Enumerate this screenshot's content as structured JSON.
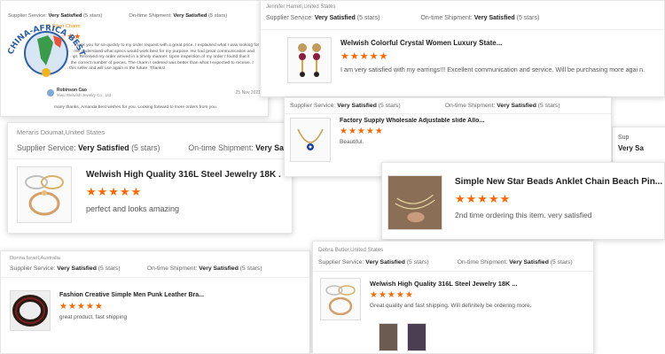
{
  "watermark": {
    "text": "CHINA-AFRICA BEST TRADING PLATFORM"
  },
  "card1": {
    "supplier_label": "Supplier Service:",
    "supplier_value": "Very Satisfied",
    "supplier_stars": "(5 stars)",
    "shipment_label": "On-time Shipment:",
    "shipment_value": "Very Satisfied",
    "shipment_stars": "(5 stars)",
    "badge": "#1 Silver Charm",
    "review": "I just want to... thank you for so quickly to my order request with a great price. I explained what I was looking for and he helped me understand what specs would work best for my purpose. He had great communication and was very prompt. Received my order arrived in a timely manner. Upon inspection of my order I found that it contained all the correct number of pieces. The charm I ordered was better than what I expected to receive. I recommend this seller and will use again in the future. Thanks!",
    "reply_name": "Robinson Cao",
    "reply_company": "Yiwu Welwish Jewelry Co., Ltd",
    "reply_date": "25 Nov 2021",
    "reply_text": "many thanks, Amanda,best wishes for you. Looking forward to more orders from you."
  },
  "card2": {
    "reviewer": "Jennifer Harrell,United States",
    "supplier_label": "Supplier Service:",
    "supplier_value": "Very Satisfied",
    "supplier_stars": "(5 stars)",
    "shipment_label": "On-time Shipment:",
    "shipment_value": "Very Satisfied",
    "shipment_stars": "(5 stars)",
    "product_title": "Welwish Colorful Crystal Women Luxury State...",
    "stars": "★★★★★",
    "review": "I am very satisfied with my earrings!!! Excellent communication and service. Will be purchasing more agai n."
  },
  "card3": {
    "supplier_label": "Supplier Service:",
    "supplier_value": "Very Satisfied",
    "supplier_stars": "(5 stars)",
    "shipment_label": "On-time Shipment:",
    "shipment_value": "Very Satisfied",
    "shipment_stars": "(5 stars)",
    "product_title": "Factory Supply Wholesale Adjustable slide Allo...",
    "stars": "★★★★★",
    "review": "Beautiful."
  },
  "card4": {
    "reviewer": "Meraris Doumat,United States",
    "supplier_label": "Supplier Service:",
    "supplier_value": "Very Satisfied",
    "supplier_stars": "(5 stars)",
    "shipment_label": "On-time Shipment:",
    "shipment_value": "Very Satisfied",
    "product_title": "Welwish High Quality 316L Steel Jewelry 18K ...",
    "stars": "★★★★★",
    "review": "perfect and looks amazing"
  },
  "card5": {
    "product_title": "Simple New Star Beads Anklet Chain Beach Pin...",
    "stars": "★★★★★",
    "review": "2nd time ordering this item. very satisfied"
  },
  "card6": {
    "reviewer": "Donna Israel,Australia",
    "supplier_label": "Supplier Service:",
    "supplier_value": "Very Satisfied",
    "supplier_stars": "(5 stars)",
    "shipment_label": "On-time Shipment:",
    "shipment_value": "Very Satisfied",
    "shipment_stars": "(5 stars)",
    "product_title": "Fashion Creative Simple Men Punk Leather Bra...",
    "stars": "★★★★★",
    "review": "great product, fast shipping"
  },
  "card7": {
    "reviewer": "Debra Butler,United States",
    "supplier_label": "Supplier Service:",
    "supplier_value": "Very Satisfied",
    "supplier_stars": "(5 stars)",
    "shipment_label": "On-time Shipment:",
    "shipment_value": "Very Satisfied",
    "shipment_stars": "(5 stars)",
    "product_title": "Welwish High Quality 316L Steel Jewelry 18K ...",
    "stars": "★★★★★",
    "review": "Great quality and fast shipping. Will definitely be ordering more."
  },
  "card8": {
    "label": "Sup",
    "value": "Very Sa"
  }
}
